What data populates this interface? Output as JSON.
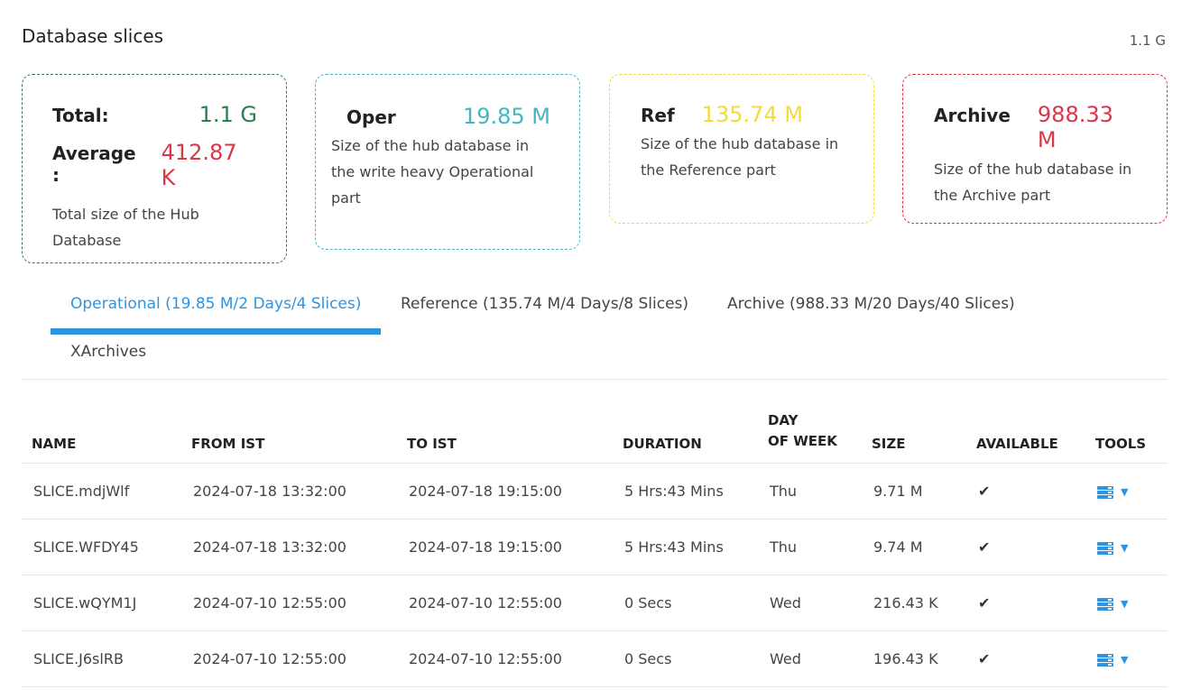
{
  "header": {
    "title": "Database slices",
    "total": "1.1 G"
  },
  "cards": {
    "total": {
      "label": "Total:",
      "value": "1.1 G",
      "avg_label": "Average :",
      "avg_value": "412.87 K",
      "desc": "Total size of the Hub Database",
      "color": "#2e7d4f",
      "avg_color": "#d9364a"
    },
    "oper": {
      "label": "Oper",
      "value": "19.85 M",
      "desc": "Size of the hub database in the write heavy Operational part",
      "color": "#45b5c0"
    },
    "ref": {
      "label": "Ref",
      "value": "135.74 M",
      "desc": "Size of the hub database in the Reference part",
      "color": "#f0dd3a"
    },
    "archive": {
      "label": "Archive",
      "value": "988.33 M",
      "desc": "Size of the hub database in the Archive part",
      "color": "#d9364a"
    }
  },
  "tabs": [
    {
      "label": "Operational (19.85 M/2 Days/4 Slices)",
      "active": true
    },
    {
      "label": "Reference (135.74 M/4 Days/8 Slices)",
      "active": false
    },
    {
      "label": "Archive (988.33 M/20 Days/40 Slices)",
      "active": false
    },
    {
      "label": "XArchives",
      "active": false
    }
  ],
  "table": {
    "headers": {
      "name": "NAME",
      "from": "FROM IST",
      "to": "TO IST",
      "duration": "DURATION",
      "day_line1": "DAY",
      "day_line2": "OF WEEK",
      "size": "SIZE",
      "available": "AVAILABLE",
      "tools": "TOOLS"
    },
    "rows": [
      {
        "name": "SLICE.mdjWlf",
        "from": "2024-07-18 13:32:00",
        "to": "2024-07-18 19:15:00",
        "duration": "5 Hrs:43 Mins",
        "day": "Thu",
        "size": "9.71 M",
        "available": "✔"
      },
      {
        "name": "SLICE.WFDY45",
        "from": "2024-07-18 13:32:00",
        "to": "2024-07-18 19:15:00",
        "duration": "5 Hrs:43 Mins",
        "day": "Thu",
        "size": "9.74 M",
        "available": "✔"
      },
      {
        "name": "SLICE.wQYM1J",
        "from": "2024-07-10 12:55:00",
        "to": "2024-07-10 12:55:00",
        "duration": "0 Secs",
        "day": "Wed",
        "size": "216.43 K",
        "available": "✔"
      },
      {
        "name": "SLICE.J6slRB",
        "from": "2024-07-10 12:55:00",
        "to": "2024-07-10 12:55:00",
        "duration": "0 Secs",
        "day": "Wed",
        "size": "196.43 K",
        "available": "✔"
      }
    ],
    "tools_icon": "database-icon",
    "dropdown_icon": "caret-down-icon"
  }
}
